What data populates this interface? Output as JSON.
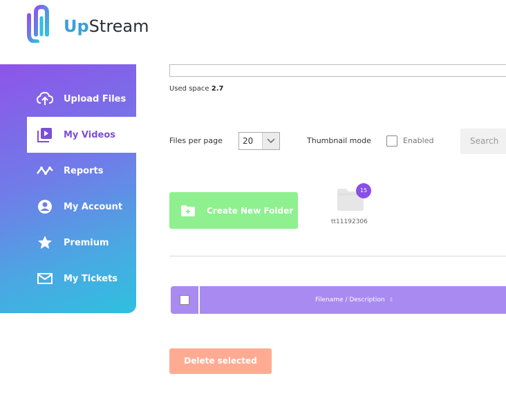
{
  "brand": {
    "name_part1": "Up",
    "name_part2": "Stream"
  },
  "sidebar": {
    "items": [
      {
        "label": "Upload Files",
        "icon": "upload-cloud-icon"
      },
      {
        "label": "My Videos",
        "icon": "video-library-icon",
        "active": true
      },
      {
        "label": "Reports",
        "icon": "activity-wave-icon"
      },
      {
        "label": "My Account",
        "icon": "user-circle-icon"
      },
      {
        "label": "Premium",
        "icon": "star-icon"
      },
      {
        "label": "My Tickets",
        "icon": "envelope-icon"
      }
    ]
  },
  "storage": {
    "used_label": "Used space",
    "used_value": "2.7"
  },
  "controls": {
    "files_per_page_label": "Files per page",
    "files_per_page_value": "20",
    "thumbnail_mode_label": "Thumbnail mode",
    "enabled_label": "Enabled",
    "search_label": "Search"
  },
  "folders": {
    "create_label": "Create New Folder",
    "items": [
      {
        "name": "tt11192306",
        "count": "15"
      }
    ]
  },
  "table": {
    "filename_header": "Filename / Description",
    "sort_glyph": "⇕"
  },
  "actions": {
    "delete_selected": "Delete selected"
  },
  "colors": {
    "accent": "#8a4fe6",
    "create_folder": "#8ef08e",
    "delete": "#ffab94",
    "table_header": "#a98af0"
  }
}
